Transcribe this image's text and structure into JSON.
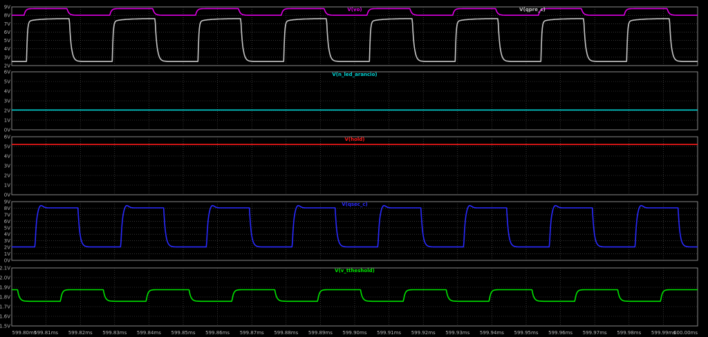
{
  "chart_data": {
    "type": "line",
    "x_unit": "ms",
    "x_range": [
      599.8,
      600.0
    ],
    "x_ticks": [
      "599.80ms",
      "599.81ms",
      "599.82ms",
      "599.83ms",
      "599.84ms",
      "599.85ms",
      "599.86ms",
      "599.87ms",
      "599.88ms",
      "599.89ms",
      "599.90ms",
      "599.91ms",
      "599.92ms",
      "599.93ms",
      "599.94ms",
      "599.95ms",
      "599.96ms",
      "599.97ms",
      "599.98ms",
      "599.99ms",
      "600.00ms"
    ],
    "grid": true,
    "panes": [
      {
        "ylim": [
          2,
          9
        ],
        "y_ticks": [
          "2V",
          "3V",
          "4V",
          "5V",
          "6V",
          "7V",
          "8V",
          "9V"
        ],
        "traces": [
          {
            "label": "V(vo)",
            "label_pos": "center",
            "color": "#e100e6",
            "kind": "square",
            "low": 8.0,
            "high": 8.8,
            "period_ms": 0.025,
            "first_rise_ms": 599.8036,
            "duty": 0.5
          },
          {
            "label": "V(qpre_c)",
            "label_pos": "right",
            "color": "#c8c8c8",
            "kind": "square_inverted",
            "low": 2.5,
            "high": 7.6,
            "period_ms": 0.025,
            "first_fall_ms": 599.8168,
            "duty": 0.5
          }
        ]
      },
      {
        "ylim": [
          0,
          6
        ],
        "y_ticks": [
          "0V",
          "1V",
          "2V",
          "3V",
          "4V",
          "5V",
          "6V"
        ],
        "traces": [
          {
            "label": "V(n_led_arancio)",
            "label_pos": "center",
            "color": "#00d2d2",
            "kind": "flat",
            "value": 2.05
          }
        ]
      },
      {
        "ylim": [
          0,
          6
        ],
        "y_ticks": [
          "0V",
          "1V",
          "2V",
          "3V",
          "4V",
          "5V",
          "6V"
        ],
        "traces": [
          {
            "label": "V(hold)",
            "label_pos": "center",
            "color": "#ff1a1a",
            "kind": "flat",
            "value": 5.2
          }
        ]
      },
      {
        "ylim": [
          0,
          9
        ],
        "y_ticks": [
          "0V",
          "1V",
          "2V",
          "3V",
          "4V",
          "5V",
          "6V",
          "7V",
          "8V",
          "9V"
        ],
        "traces": [
          {
            "label": "V(qsec_c)",
            "label_pos": "center",
            "color": "#2a2aff",
            "kind": "square",
            "low": 2.05,
            "high": 8.05,
            "overshoot": 0.5,
            "period_ms": 0.025,
            "first_rise_ms": 599.8068,
            "duty": 0.5
          }
        ]
      },
      {
        "ylim": [
          1.5,
          2.1
        ],
        "y_ticks": [
          "1.5V",
          "1.6V",
          "1.7V",
          "1.8V",
          "1.9V",
          "2.0V",
          "2.1V"
        ],
        "traces": [
          {
            "label": "V(v_ttheshold)",
            "label_pos": "center",
            "color": "#00e600",
            "kind": "square",
            "low": 1.755,
            "high": 1.875,
            "period_ms": 0.025,
            "first_rise_ms": 599.8142,
            "duty": 0.5,
            "start_high": true
          }
        ]
      }
    ]
  }
}
